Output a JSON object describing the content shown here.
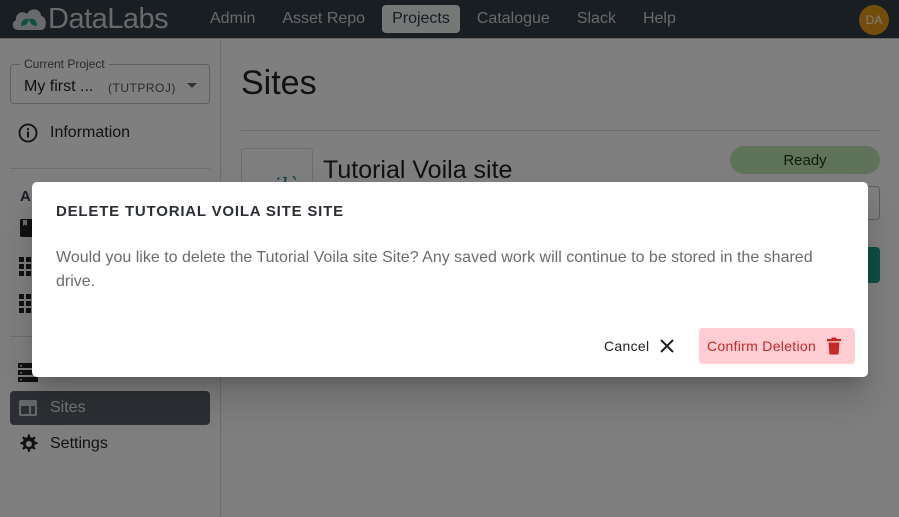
{
  "app": {
    "brand": "DataLabs"
  },
  "nav": {
    "items": [
      {
        "label": "Admin",
        "active": false
      },
      {
        "label": "Asset Repo",
        "active": false
      },
      {
        "label": "Projects",
        "active": true
      },
      {
        "label": "Catalogue",
        "active": false
      },
      {
        "label": "Slack",
        "active": false
      },
      {
        "label": "Help",
        "active": false
      }
    ],
    "avatar_initials": "DA",
    "avatar_color": "#e59a16"
  },
  "sidebar": {
    "project_select": {
      "legend": "Current Project",
      "name": "My first ...",
      "key": "(TUTPROJ)"
    },
    "information_label": "Information",
    "section_header_partial": "A",
    "sites_label": "Sites",
    "settings_label": "Settings"
  },
  "main": {
    "title": "Sites",
    "site": {
      "thumb_text": "voilà",
      "name": "Tutorial Voila site",
      "status": "Ready"
    }
  },
  "dialog": {
    "title": "DELETE TUTORIAL VOILA SITE SITE",
    "body": "Would you like to delete the Tutorial Voila site Site? Any saved work will continue to be stored in the shared drive.",
    "cancel_label": "Cancel",
    "confirm_label": "Confirm Deletion",
    "confirm_color": "#c62828",
    "confirm_bg": "#ffcdd2"
  }
}
